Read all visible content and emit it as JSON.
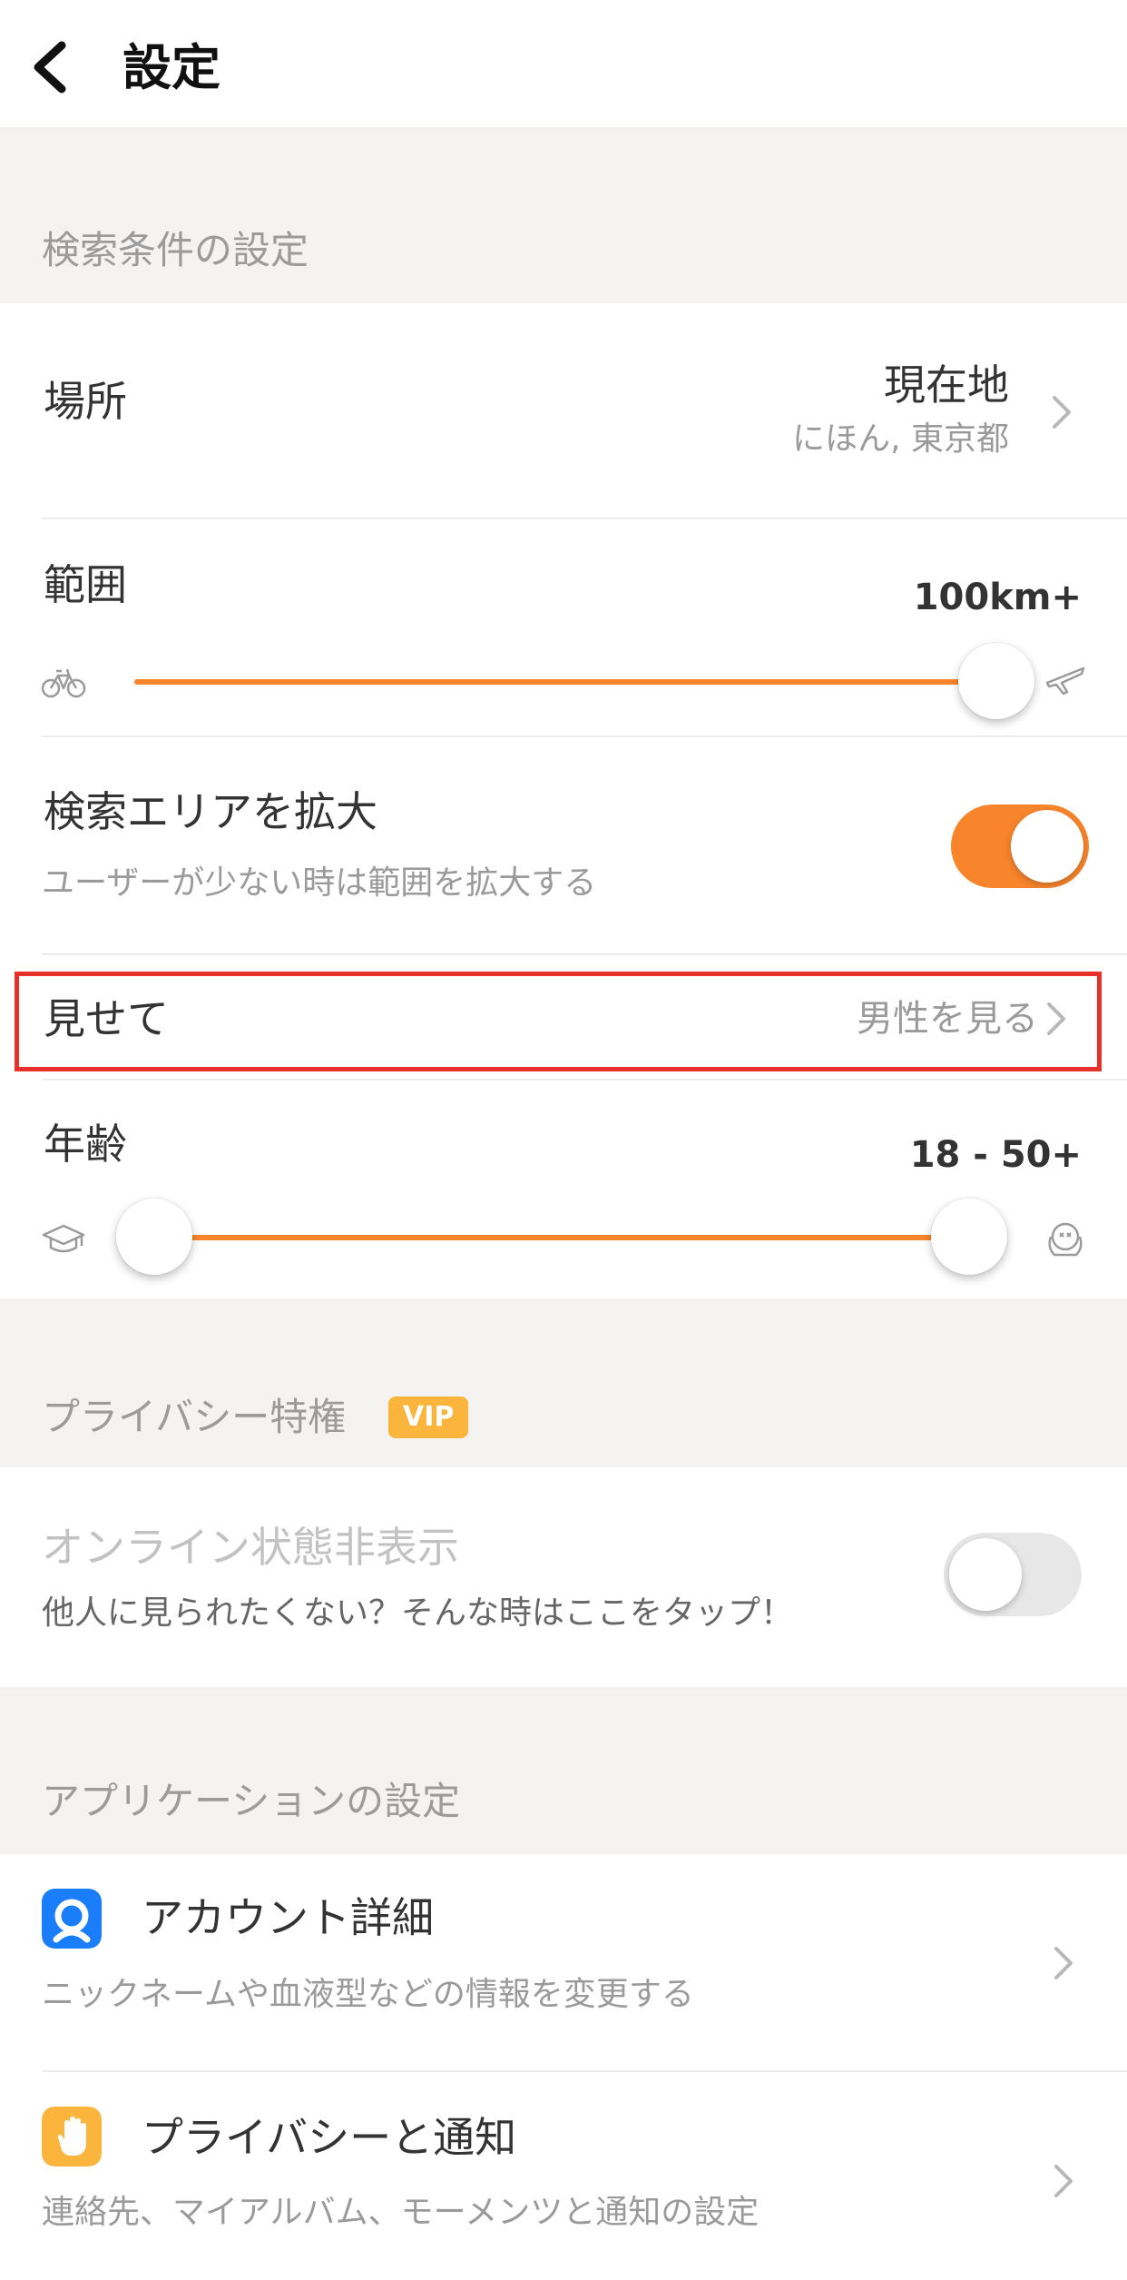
{
  "header": {
    "title": "設定",
    "back_icon": "chevron-left-icon"
  },
  "search_section": {
    "title": "検索条件の設定",
    "location": {
      "label": "場所",
      "value": "現在地",
      "sub_value": "にほん, 東京都"
    },
    "range": {
      "label": "範囲",
      "value": "100km+",
      "slider_fraction": 1.0,
      "min_icon": "bicycle-icon",
      "max_icon": "airplane-icon"
    },
    "expand_area": {
      "label": "検索エリアを拡大",
      "description": "ユーザーが少ない時は範囲を拡大する",
      "enabled": true
    },
    "show": {
      "label": "見せて",
      "value": "男性を見る"
    },
    "age": {
      "label": "年齢",
      "value": "18 - 50+",
      "low": 18,
      "high": "50+",
      "min_icon": "graduation-cap-icon",
      "max_icon": "elder-face-icon"
    }
  },
  "privacy_section": {
    "title": "プライバシー特権",
    "badge": "VIP",
    "hide_online": {
      "label": "オンライン状態非表示",
      "description": "他人に見られたくない？そんな時はここをタップ！",
      "enabled": false
    }
  },
  "app_section": {
    "title": "アプリケーションの設定",
    "items": [
      {
        "label": "アカウント詳細",
        "description": "ニックネームや血液型などの情報を変更する",
        "icon": "user-icon",
        "icon_color": "#1a7dfa"
      },
      {
        "label": "プライバシーと通知",
        "description": "連絡先、マイアルバム、モーメンツと通知の設定",
        "icon": "hand-icon",
        "icon_color": "#fcb53c"
      }
    ]
  },
  "colors": {
    "accent": "#f8852b",
    "highlight": "#e8302a",
    "vip": "#fcb53c"
  }
}
